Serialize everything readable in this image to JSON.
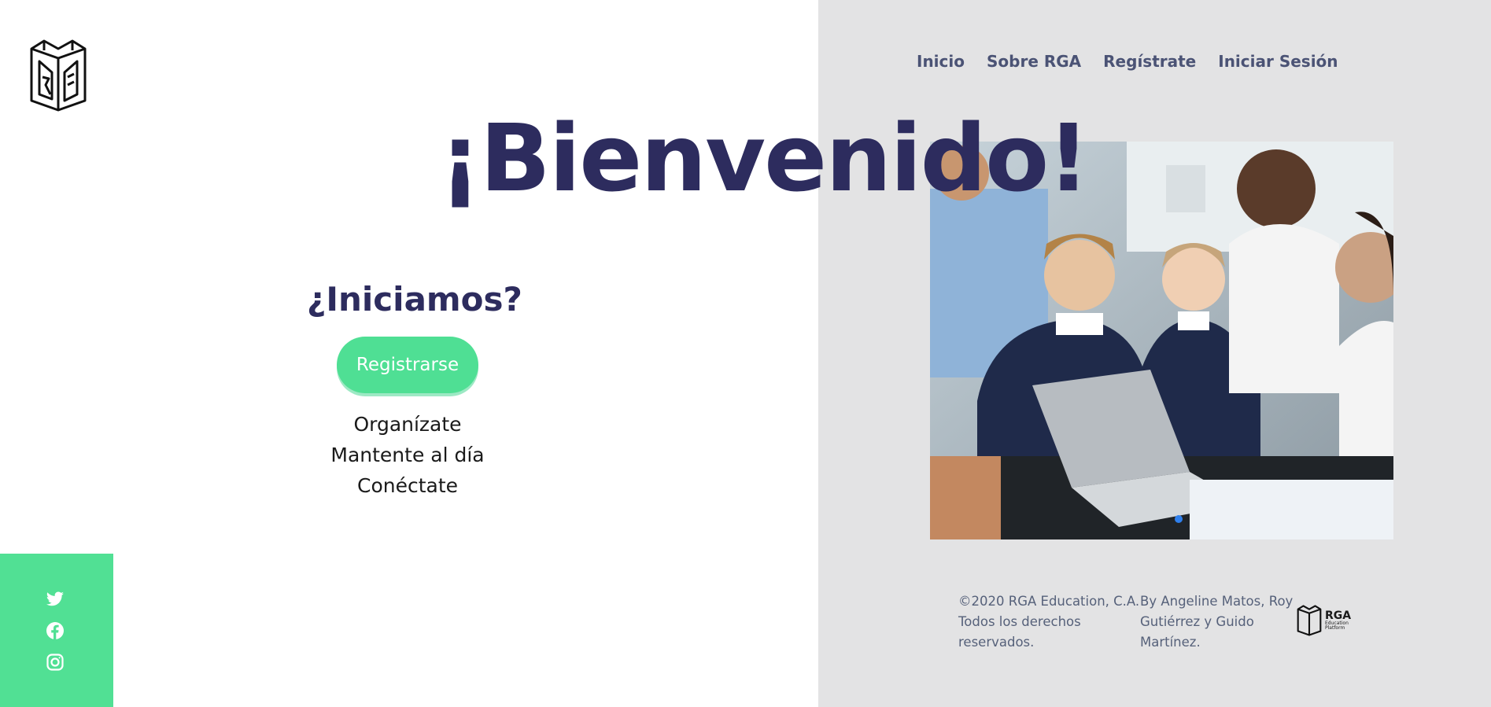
{
  "nav": {
    "items": [
      "Inicio",
      "Sobre RGA",
      "Regístrate",
      "Iniciar Sesión"
    ]
  },
  "hero": {
    "title": "¡Bienvenido!",
    "subtitle": "¿Iniciamos?",
    "cta": "Registrarse",
    "features": [
      "Organízate",
      "Mantente al día",
      "Conéctate"
    ]
  },
  "social": {
    "icons": [
      "twitter-icon",
      "facebook-icon",
      "instagram-icon"
    ]
  },
  "footer": {
    "copyright": "©2020 RGA Education, C.A. Todos los derechos reservados.",
    "authors": "By Angeline Matos, Roy Gutiérrez y Guido Martínez.",
    "logo_title": "RGA",
    "logo_sub1": "Education",
    "logo_sub2": "Platform"
  },
  "colors": {
    "accent": "#51e094",
    "title": "#2d2c5e",
    "nav": "#4b5375",
    "panel": "#e3e3e4"
  }
}
